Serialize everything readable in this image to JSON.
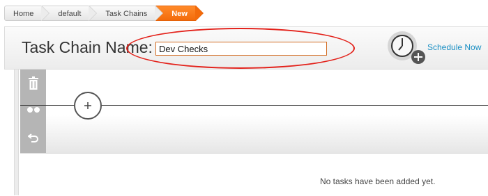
{
  "breadcrumb": {
    "items": [
      "Home",
      "default",
      "Task Chains"
    ],
    "current": "New",
    "accent_color": "#f36b0b"
  },
  "header": {
    "label": "Task Chain Name:",
    "name_value": "Dev Checks",
    "schedule_label": "Schedule Now",
    "schedule_icon": "clock-plus-icon"
  },
  "annotation": {
    "shape": "ellipse",
    "color": "#e3211a",
    "target": "task-chain-name-input"
  },
  "toolbar": {
    "icons": [
      "trash-icon",
      "link-dots-icon",
      "undo-icon"
    ]
  },
  "chain": {
    "add_icon": "plus-circle-icon"
  },
  "tasks": {
    "empty_message": "No tasks have been added yet."
  }
}
